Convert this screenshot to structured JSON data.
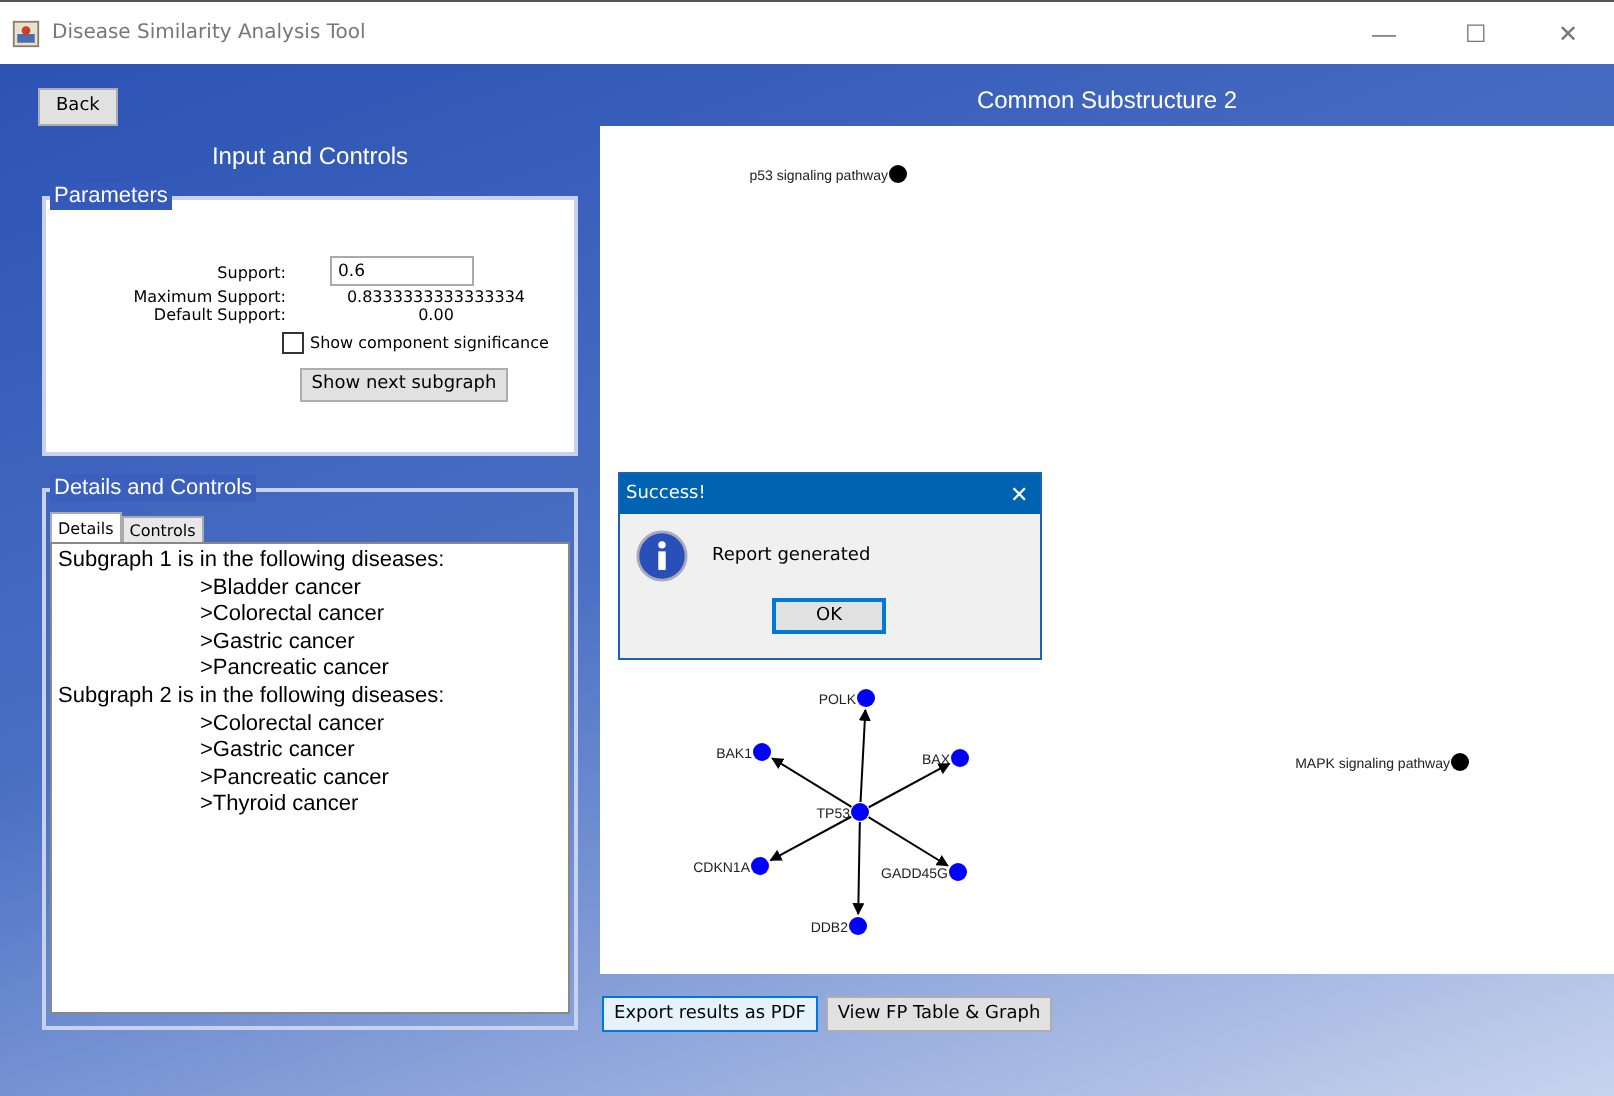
{
  "window": {
    "title": "Disease Similarity Analysis Tool",
    "controls": [
      "—",
      "☐",
      "✕"
    ]
  },
  "back_button": "Back",
  "left_panel": {
    "title": "Input and Controls",
    "parameters": {
      "legend": "Parameters",
      "fields": [
        {
          "label": "Support:",
          "kind": "input",
          "value": "0.6"
        },
        {
          "label": "Maximum Support:",
          "kind": "text",
          "value": "0.8333333333333334"
        },
        {
          "label": "Default Support:",
          "kind": "text",
          "value": "0.00"
        }
      ],
      "checkbox": {
        "label": "Show component significance",
        "checked": false
      },
      "button": "Show next subgraph"
    },
    "details": {
      "legend": "Details and Controls",
      "tabs": [
        {
          "label": "Details",
          "selected": true
        },
        {
          "label": "Controls",
          "selected": false
        }
      ],
      "groups": [
        {
          "heading": "Subgraph 1 is in the following diseases:",
          "items": [
            ">Bladder cancer",
            ">Colorectal cancer",
            ">Gastric cancer",
            ">Pancreatic cancer"
          ]
        },
        {
          "heading": "Subgraph 2 is in the following diseases:",
          "items": [
            ">Colorectal cancer",
            ">Gastric cancer",
            ">Pancreatic cancer",
            ">Thyroid cancer"
          ]
        }
      ]
    }
  },
  "graph": {
    "title": "Common Substructure 2",
    "nodes": [
      {
        "label": "p53 signaling pathway",
        "kind": "pathway"
      },
      {
        "label": "MAPK signaling pathway",
        "kind": "pathway"
      },
      {
        "label": "TP53",
        "kind": "gene",
        "targets": [
          {
            "label": "POLK"
          },
          {
            "label": "BAK1"
          },
          {
            "label": "BAX"
          },
          {
            "label": "CDKN1A"
          },
          {
            "label": "GADD45G"
          },
          {
            "label": "DDB2"
          }
        ]
      }
    ]
  },
  "dialog": {
    "title": "Success!",
    "message": "Report generated",
    "button": "OK",
    "close": "✕"
  },
  "bottom_buttons": [
    {
      "label": "Export results as PDF",
      "selected": true
    },
    {
      "label": "View FP Table & Graph",
      "selected": false
    }
  ]
}
